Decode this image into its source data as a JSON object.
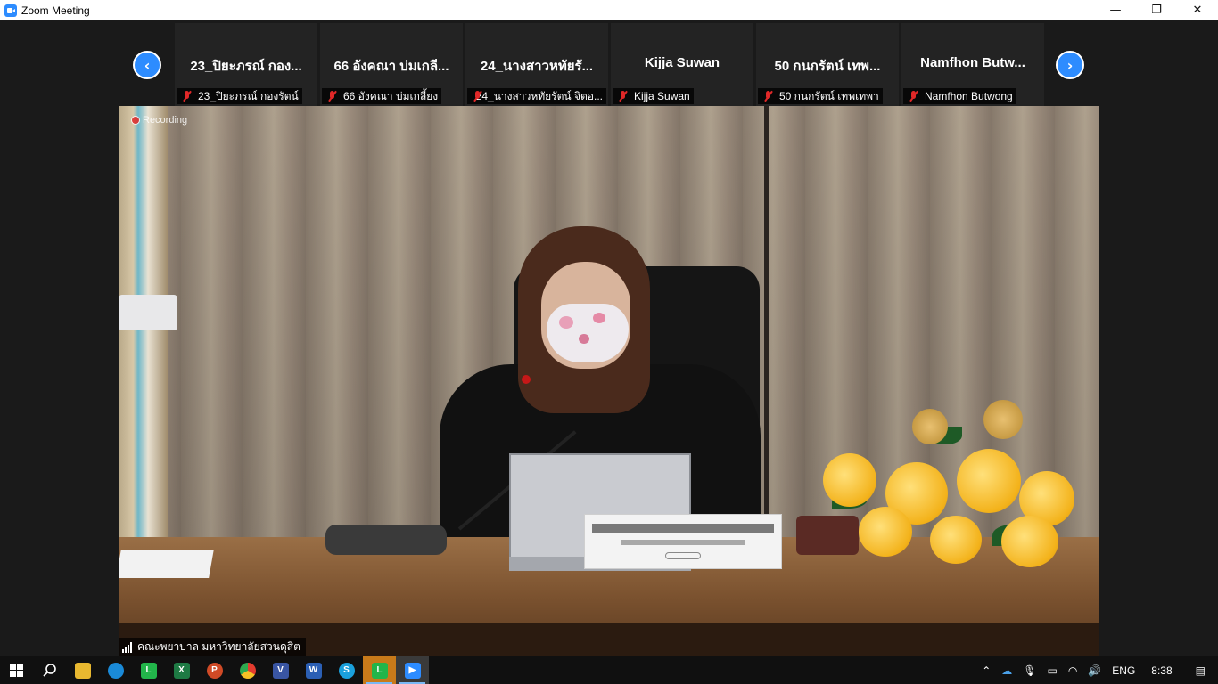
{
  "window": {
    "title": "Zoom Meeting",
    "minimize": "—",
    "restore": "❐",
    "close": "✕"
  },
  "thumbnails": [
    {
      "name": "23_ปิยะภรณ์ กอง...",
      "label": "23_ปิยะภรณ์ กองรัตน์"
    },
    {
      "name": "66 อังคณา บ่มเกลี...",
      "label": "66 อังคณา บ่มเกลี้ยง"
    },
    {
      "name": "24_นางสาวหทัยรั...",
      "label": "24_นางสาวหทัยรัตน์ จิตอ..."
    },
    {
      "name": "Kijja Suwan",
      "label": "Kijja Suwan"
    },
    {
      "name": "50 กนกรัตน์ เทพ...",
      "label": "50 กนกรัตน์ เทพเทพา"
    },
    {
      "name": "Namfhon Butw...",
      "label": "Namfhon Butwong"
    }
  ],
  "nav": {
    "prev": "‹",
    "next": "›"
  },
  "video": {
    "recording": "Recording",
    "speaker": "คณะพยาบาล มหาวิทยาลัยสวนดุสิต"
  },
  "taskbar": {
    "apps": [
      "start",
      "search",
      "file-explorer",
      "edge",
      "line",
      "excel",
      "powerpoint",
      "chrome",
      "visio",
      "word",
      "skype",
      "line-active",
      "zoom"
    ],
    "language": "ENG",
    "time": "8:38"
  },
  "colors": {
    "accent": "#2d8cff",
    "muted_mic": "#e02828",
    "background": "#1a1a1a"
  }
}
